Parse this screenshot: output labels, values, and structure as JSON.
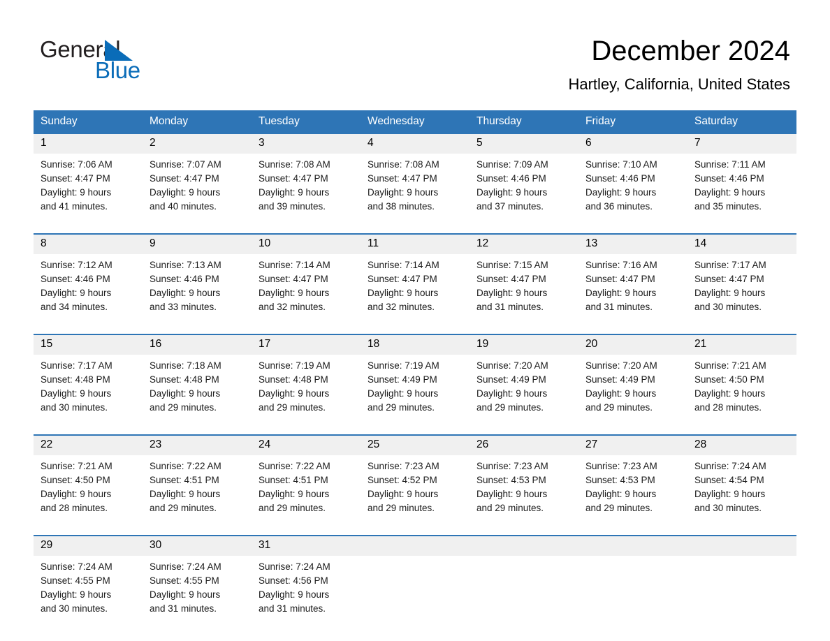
{
  "brand": {
    "word1": "General",
    "word2": "Blue",
    "triangle_color": "#0a6cb8",
    "text_color": "#231f20"
  },
  "header": {
    "title": "December 2024",
    "location": "Hartley, California, United States"
  },
  "theme": {
    "header_blue": "#2e75b6",
    "row_divider_blue": "#2e75b6",
    "daynum_band": "#f0f0f0",
    "page_bg": "#ffffff"
  },
  "weekdays": [
    "Sunday",
    "Monday",
    "Tuesday",
    "Wednesday",
    "Thursday",
    "Friday",
    "Saturday"
  ],
  "weeks": [
    [
      {
        "day": "1",
        "sunrise": "Sunrise: 7:06 AM",
        "sunset": "Sunset: 4:47 PM",
        "daylight_line1": "Daylight: 9 hours",
        "daylight_line2": "and 41 minutes."
      },
      {
        "day": "2",
        "sunrise": "Sunrise: 7:07 AM",
        "sunset": "Sunset: 4:47 PM",
        "daylight_line1": "Daylight: 9 hours",
        "daylight_line2": "and 40 minutes."
      },
      {
        "day": "3",
        "sunrise": "Sunrise: 7:08 AM",
        "sunset": "Sunset: 4:47 PM",
        "daylight_line1": "Daylight: 9 hours",
        "daylight_line2": "and 39 minutes."
      },
      {
        "day": "4",
        "sunrise": "Sunrise: 7:08 AM",
        "sunset": "Sunset: 4:47 PM",
        "daylight_line1": "Daylight: 9 hours",
        "daylight_line2": "and 38 minutes."
      },
      {
        "day": "5",
        "sunrise": "Sunrise: 7:09 AM",
        "sunset": "Sunset: 4:46 PM",
        "daylight_line1": "Daylight: 9 hours",
        "daylight_line2": "and 37 minutes."
      },
      {
        "day": "6",
        "sunrise": "Sunrise: 7:10 AM",
        "sunset": "Sunset: 4:46 PM",
        "daylight_line1": "Daylight: 9 hours",
        "daylight_line2": "and 36 minutes."
      },
      {
        "day": "7",
        "sunrise": "Sunrise: 7:11 AM",
        "sunset": "Sunset: 4:46 PM",
        "daylight_line1": "Daylight: 9 hours",
        "daylight_line2": "and 35 minutes."
      }
    ],
    [
      {
        "day": "8",
        "sunrise": "Sunrise: 7:12 AM",
        "sunset": "Sunset: 4:46 PM",
        "daylight_line1": "Daylight: 9 hours",
        "daylight_line2": "and 34 minutes."
      },
      {
        "day": "9",
        "sunrise": "Sunrise: 7:13 AM",
        "sunset": "Sunset: 4:46 PM",
        "daylight_line1": "Daylight: 9 hours",
        "daylight_line2": "and 33 minutes."
      },
      {
        "day": "10",
        "sunrise": "Sunrise: 7:14 AM",
        "sunset": "Sunset: 4:47 PM",
        "daylight_line1": "Daylight: 9 hours",
        "daylight_line2": "and 32 minutes."
      },
      {
        "day": "11",
        "sunrise": "Sunrise: 7:14 AM",
        "sunset": "Sunset: 4:47 PM",
        "daylight_line1": "Daylight: 9 hours",
        "daylight_line2": "and 32 minutes."
      },
      {
        "day": "12",
        "sunrise": "Sunrise: 7:15 AM",
        "sunset": "Sunset: 4:47 PM",
        "daylight_line1": "Daylight: 9 hours",
        "daylight_line2": "and 31 minutes."
      },
      {
        "day": "13",
        "sunrise": "Sunrise: 7:16 AM",
        "sunset": "Sunset: 4:47 PM",
        "daylight_line1": "Daylight: 9 hours",
        "daylight_line2": "and 31 minutes."
      },
      {
        "day": "14",
        "sunrise": "Sunrise: 7:17 AM",
        "sunset": "Sunset: 4:47 PM",
        "daylight_line1": "Daylight: 9 hours",
        "daylight_line2": "and 30 minutes."
      }
    ],
    [
      {
        "day": "15",
        "sunrise": "Sunrise: 7:17 AM",
        "sunset": "Sunset: 4:48 PM",
        "daylight_line1": "Daylight: 9 hours",
        "daylight_line2": "and 30 minutes."
      },
      {
        "day": "16",
        "sunrise": "Sunrise: 7:18 AM",
        "sunset": "Sunset: 4:48 PM",
        "daylight_line1": "Daylight: 9 hours",
        "daylight_line2": "and 29 minutes."
      },
      {
        "day": "17",
        "sunrise": "Sunrise: 7:19 AM",
        "sunset": "Sunset: 4:48 PM",
        "daylight_line1": "Daylight: 9 hours",
        "daylight_line2": "and 29 minutes."
      },
      {
        "day": "18",
        "sunrise": "Sunrise: 7:19 AM",
        "sunset": "Sunset: 4:49 PM",
        "daylight_line1": "Daylight: 9 hours",
        "daylight_line2": "and 29 minutes."
      },
      {
        "day": "19",
        "sunrise": "Sunrise: 7:20 AM",
        "sunset": "Sunset: 4:49 PM",
        "daylight_line1": "Daylight: 9 hours",
        "daylight_line2": "and 29 minutes."
      },
      {
        "day": "20",
        "sunrise": "Sunrise: 7:20 AM",
        "sunset": "Sunset: 4:49 PM",
        "daylight_line1": "Daylight: 9 hours",
        "daylight_line2": "and 29 minutes."
      },
      {
        "day": "21",
        "sunrise": "Sunrise: 7:21 AM",
        "sunset": "Sunset: 4:50 PM",
        "daylight_line1": "Daylight: 9 hours",
        "daylight_line2": "and 28 minutes."
      }
    ],
    [
      {
        "day": "22",
        "sunrise": "Sunrise: 7:21 AM",
        "sunset": "Sunset: 4:50 PM",
        "daylight_line1": "Daylight: 9 hours",
        "daylight_line2": "and 28 minutes."
      },
      {
        "day": "23",
        "sunrise": "Sunrise: 7:22 AM",
        "sunset": "Sunset: 4:51 PM",
        "daylight_line1": "Daylight: 9 hours",
        "daylight_line2": "and 29 minutes."
      },
      {
        "day": "24",
        "sunrise": "Sunrise: 7:22 AM",
        "sunset": "Sunset: 4:51 PM",
        "daylight_line1": "Daylight: 9 hours",
        "daylight_line2": "and 29 minutes."
      },
      {
        "day": "25",
        "sunrise": "Sunrise: 7:23 AM",
        "sunset": "Sunset: 4:52 PM",
        "daylight_line1": "Daylight: 9 hours",
        "daylight_line2": "and 29 minutes."
      },
      {
        "day": "26",
        "sunrise": "Sunrise: 7:23 AM",
        "sunset": "Sunset: 4:53 PM",
        "daylight_line1": "Daylight: 9 hours",
        "daylight_line2": "and 29 minutes."
      },
      {
        "day": "27",
        "sunrise": "Sunrise: 7:23 AM",
        "sunset": "Sunset: 4:53 PM",
        "daylight_line1": "Daylight: 9 hours",
        "daylight_line2": "and 29 minutes."
      },
      {
        "day": "28",
        "sunrise": "Sunrise: 7:24 AM",
        "sunset": "Sunset: 4:54 PM",
        "daylight_line1": "Daylight: 9 hours",
        "daylight_line2": "and 30 minutes."
      }
    ],
    [
      {
        "day": "29",
        "sunrise": "Sunrise: 7:24 AM",
        "sunset": "Sunset: 4:55 PM",
        "daylight_line1": "Daylight: 9 hours",
        "daylight_line2": "and 30 minutes."
      },
      {
        "day": "30",
        "sunrise": "Sunrise: 7:24 AM",
        "sunset": "Sunset: 4:55 PM",
        "daylight_line1": "Daylight: 9 hours",
        "daylight_line2": "and 31 minutes."
      },
      {
        "day": "31",
        "sunrise": "Sunrise: 7:24 AM",
        "sunset": "Sunset: 4:56 PM",
        "daylight_line1": "Daylight: 9 hours",
        "daylight_line2": "and 31 minutes."
      },
      {
        "day": "",
        "sunrise": "",
        "sunset": "",
        "daylight_line1": "",
        "daylight_line2": ""
      },
      {
        "day": "",
        "sunrise": "",
        "sunset": "",
        "daylight_line1": "",
        "daylight_line2": ""
      },
      {
        "day": "",
        "sunrise": "",
        "sunset": "",
        "daylight_line1": "",
        "daylight_line2": ""
      },
      {
        "day": "",
        "sunrise": "",
        "sunset": "",
        "daylight_line1": "",
        "daylight_line2": ""
      }
    ]
  ]
}
